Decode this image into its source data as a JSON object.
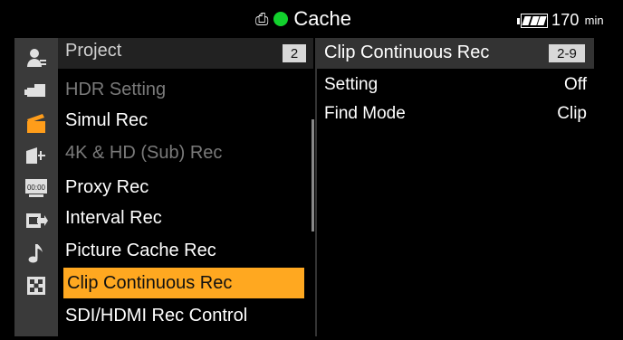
{
  "topbar": {
    "media_status": "Cache",
    "battery_remaining": "170",
    "battery_unit": "min",
    "indicator_color": "#12d12d"
  },
  "icons": [
    {
      "name": "camera-user-icon",
      "glyph": "👤"
    },
    {
      "name": "camera-icon",
      "glyph": "▬"
    },
    {
      "name": "clapper-icon",
      "glyph": "◢"
    },
    {
      "name": "tv-icon",
      "glyph": "◪"
    },
    {
      "name": "timecode-icon",
      "glyph": "00:00"
    },
    {
      "name": "output-icon",
      "glyph": "⇨"
    },
    {
      "name": "music-note-icon",
      "glyph": "♪"
    },
    {
      "name": "grid-icon",
      "glyph": "▦"
    }
  ],
  "menu": {
    "header": "Project",
    "header_badge": "2",
    "items": [
      {
        "label": "HDR Setting",
        "state": "dim"
      },
      {
        "label": "Simul Rec",
        "state": "normal"
      },
      {
        "label": "4K & HD (Sub) Rec",
        "state": "dim"
      },
      {
        "label": "Proxy Rec",
        "state": "normal"
      },
      {
        "label": "Interval Rec",
        "state": "normal"
      },
      {
        "label": "Picture Cache Rec",
        "state": "normal"
      },
      {
        "label": "Clip Continuous Rec",
        "state": "selected"
      },
      {
        "label": "SDI/HDMI Rec Control",
        "state": "normal"
      }
    ]
  },
  "detail": {
    "title": "Clip Continuous Rec",
    "badge": "2-9",
    "rows": [
      {
        "label": "Setting",
        "value": "Off"
      },
      {
        "label": "Find Mode",
        "value": "Clip"
      }
    ]
  },
  "colors": {
    "selected_bg": "#ffa820",
    "icon_column_bg": "#3a3a3a",
    "active_icon": "#ff9d1a"
  }
}
